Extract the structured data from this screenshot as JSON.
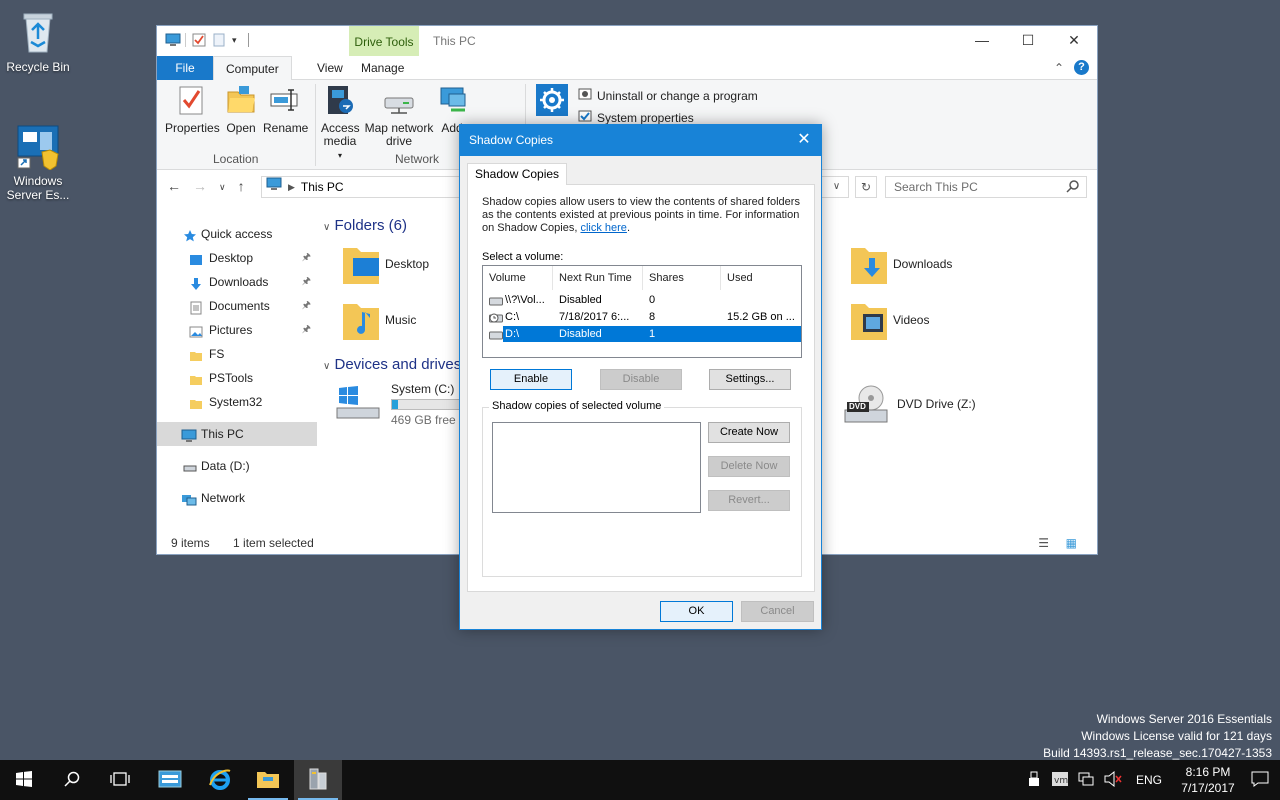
{
  "desktop": {
    "icons": [
      {
        "label": "Recycle Bin"
      },
      {
        "label": "Windows Server Es..."
      }
    ]
  },
  "explorer": {
    "title": "This PC",
    "contextual_tab": "Drive Tools",
    "tabs": [
      "File",
      "Computer",
      "View",
      "Manage"
    ],
    "ribbon": {
      "location_group": "Location",
      "network_group": "Network",
      "buttons": {
        "properties": "Properties",
        "open": "Open",
        "rename": "Rename",
        "access_media": "Access media",
        "map_drive": "Map network drive",
        "add_location": "Add"
      },
      "uninstall": "Uninstall or change a program",
      "system_properties": "System properties"
    },
    "address": "This PC",
    "search_placeholder": "Search This PC",
    "nav": {
      "quick_access": "Quick access",
      "items": [
        {
          "label": "Desktop",
          "pinned": true
        },
        {
          "label": "Downloads",
          "pinned": true
        },
        {
          "label": "Documents",
          "pinned": true
        },
        {
          "label": "Pictures",
          "pinned": true
        },
        {
          "label": "FS",
          "pinned": false
        },
        {
          "label": "PSTools",
          "pinned": false
        },
        {
          "label": "System32",
          "pinned": false
        }
      ],
      "this_pc": "This PC",
      "data_drive": "Data (D:)",
      "network": "Network"
    },
    "folders_header": "Folders (6)",
    "folders": [
      "Desktop",
      "Music",
      "Downloads",
      "Videos"
    ],
    "devices_header": "Devices and drives",
    "drives": {
      "system_c": {
        "label": "System (C:)",
        "free": "469 GB free of",
        "fill": 0.08
      },
      "dvd": {
        "label": "DVD Drive (Z:)",
        "badge": "DVD"
      }
    },
    "status": {
      "items": "9 items",
      "selected": "1 item selected"
    }
  },
  "dialog": {
    "title": "Shadow Copies",
    "tab": "Shadow Copies",
    "description": "Shadow copies allow users to view the contents of shared folders as the contents existed at previous points in time. For information on Shadow Copies,",
    "link": "click here",
    "period": ".",
    "select_label": "Select a volume:",
    "columns": [
      "Volume",
      "Next Run Time",
      "Shares",
      "Used"
    ],
    "volumes": [
      {
        "volume": "\\\\?\\Vol...",
        "next_run": "Disabled",
        "shares": "0",
        "used": ""
      },
      {
        "volume": "C:\\",
        "next_run": "7/18/2017 6:...",
        "shares": "8",
        "used": "15.2 GB on ..."
      },
      {
        "volume": "D:\\",
        "next_run": "Disabled",
        "shares": "1",
        "used": ""
      }
    ],
    "buttons": {
      "enable": "Enable",
      "disable": "Disable",
      "settings": "Settings...",
      "create_now": "Create Now",
      "delete_now": "Delete Now",
      "revert": "Revert...",
      "ok": "OK",
      "cancel": "Cancel"
    },
    "group_label": "Shadow copies of selected volume"
  },
  "watermark": {
    "line1": "Windows Server 2016 Essentials",
    "line2": "Windows License valid for 121 days",
    "line3": "Build 14393.rs1_release_sec.170427-1353"
  },
  "taskbar": {
    "language": "ENG",
    "time": "8:16 PM",
    "date": "7/17/2017"
  }
}
